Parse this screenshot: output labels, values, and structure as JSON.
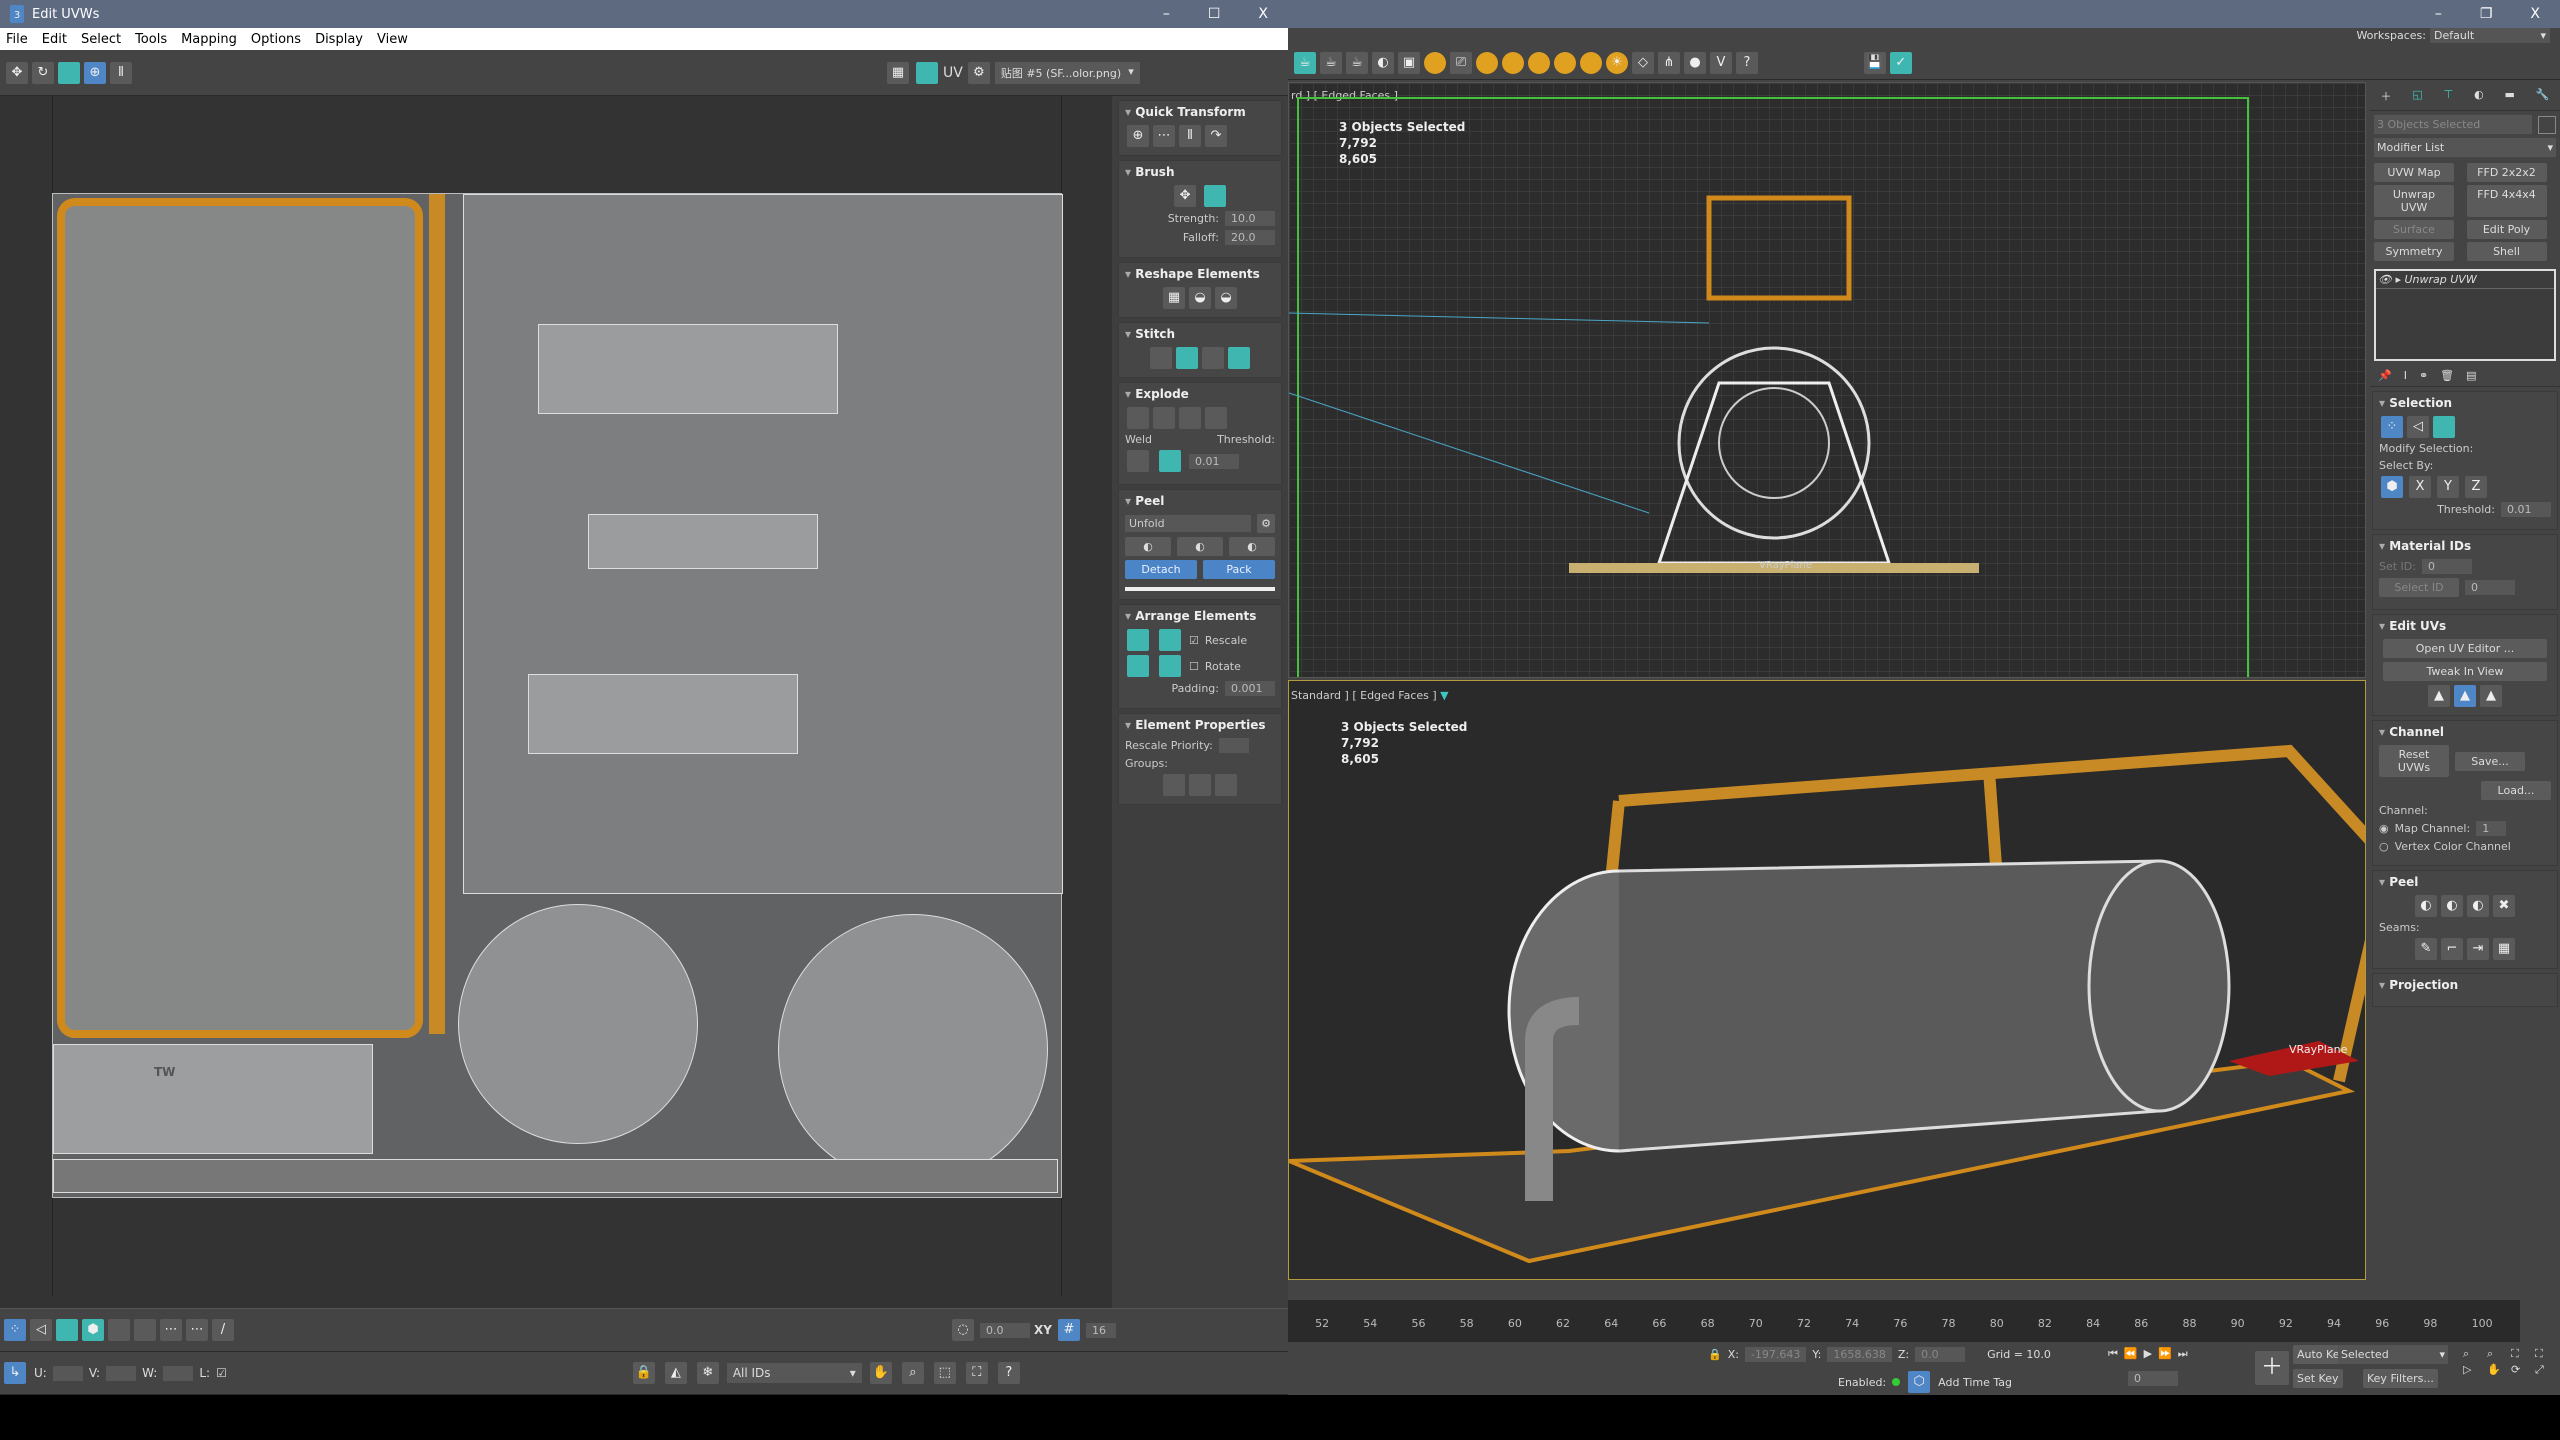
{
  "uv_editor": {
    "title": "Edit UVWs",
    "window_controls": [
      "–",
      "☐",
      "X"
    ],
    "menu": [
      "File",
      "Edit",
      "Select",
      "Tools",
      "Mapping",
      "Options",
      "Display",
      "View"
    ],
    "uv_label": "UV",
    "texture_dropdown": "贴图 #5 (SF...olor.png)",
    "rollouts": {
      "quick_transform": "Quick Transform",
      "brush": "Brush",
      "strength_label": "Strength:",
      "strength": "10.0",
      "falloff_label": "Falloff:",
      "falloff": "20.0",
      "reshape": "Reshape Elements",
      "stitch": "Stitch",
      "explode": "Explode",
      "weld": "Weld",
      "threshold_label": "Threshold:",
      "threshold": "0.01",
      "peel": "Peel",
      "unfold": "Unfold",
      "detach": "Detach",
      "pack": "Pack",
      "arrange": "Arrange Elements",
      "rescale": "Rescale",
      "rotate": "Rotate",
      "padding_label": "Padding:",
      "padding": "0.001",
      "element_props": "Element Properties",
      "rescale_priority": "Rescale Priority:",
      "groups": "Groups:"
    },
    "bottom": {
      "spin_value": "0.0",
      "xy": "XY",
      "grid_value": "16",
      "u": "U:",
      "v": "V:",
      "w": "W:",
      "l": "L:",
      "ids": "All IDs"
    },
    "canvas_text": "TW"
  },
  "max": {
    "workspaces_label": "Workspaces:",
    "workspace": "Default",
    "window_controls": [
      "–",
      "❐",
      "X"
    ],
    "top_view": {
      "label": "rd ] [ Edged Faces ]",
      "stats": [
        "3 Objects Selected",
        "7,792",
        "8,605"
      ],
      "plane": "VRayPlane"
    },
    "persp_view": {
      "label": "Standard ] [ Edged Faces ]",
      "stats": [
        "3 Objects Selected",
        "7,792",
        "8,605"
      ],
      "plane": "VRayPlane"
    },
    "command_panel": {
      "selected": "3 Objects Selected",
      "modifier_list": "Modifier List",
      "mod_buttons": [
        "UVW Map",
        "FFD 2x2x2",
        "Unwrap UVW",
        "FFD 4x4x4",
        "Surface",
        "Edit Poly",
        "Symmetry",
        "Shell"
      ],
      "stack_item": "Unwrap UVW",
      "selection": "Selection",
      "modify_selection": "Modify Selection:",
      "select_by": "Select By:",
      "threshold_label": "Threshold:",
      "threshold": "0.01",
      "material_ids": "Material IDs",
      "set_id": "Set ID:",
      "set_id_val": "0",
      "select_id": "Select ID",
      "select_id_val": "0",
      "edit_uvs": "Edit UVs",
      "open_uv_editor": "Open UV Editor ...",
      "tweak": "Tweak In View",
      "channel": "Channel",
      "reset": "Reset UVWs",
      "save": "Save...",
      "load": "Load...",
      "channel_label": "Channel:",
      "map_channel": "Map Channel:",
      "map_channel_val": "1",
      "vertex_color": "Vertex Color Channel",
      "peel": "Peel",
      "seams": "Seams:",
      "projection": "Projection"
    },
    "timeline": [
      "52",
      "54",
      "56",
      "58",
      "60",
      "62",
      "64",
      "66",
      "68",
      "70",
      "72",
      "74",
      "76",
      "78",
      "80",
      "82",
      "84",
      "86",
      "88",
      "90",
      "92",
      "94",
      "96",
      "98",
      "100"
    ],
    "status": {
      "x_label": "X:",
      "x": "-197.643",
      "y_label": "Y:",
      "y": "1658.638",
      "z_label": "Z:",
      "z": "0.0",
      "grid": "Grid = 10.0",
      "enabled": "Enabled:",
      "add_time_tag": "Add Time Tag",
      "frame": "0",
      "auto_key": "Auto Key",
      "selected": "Selected",
      "set_key": "Set Key",
      "key_filters": "Key Filters..."
    }
  }
}
